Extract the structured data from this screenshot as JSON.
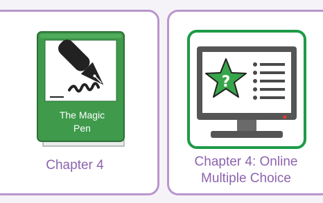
{
  "cards": [
    {
      "label": "Chapter 4",
      "book_title_line1": "The Magic",
      "book_title_line2": "Pen",
      "icon": "pen-book-icon"
    },
    {
      "label_line1": "Chapter 4: Online",
      "label_line2": "Multiple Choice",
      "icon": "quiz-monitor-icon"
    }
  ],
  "colors": {
    "card_border": "#b995cd",
    "label_text": "#8c63ae",
    "book_green": "#3f9a4c",
    "monitor_frame_green": "#1d9a47",
    "star_green": "#37a54a"
  }
}
